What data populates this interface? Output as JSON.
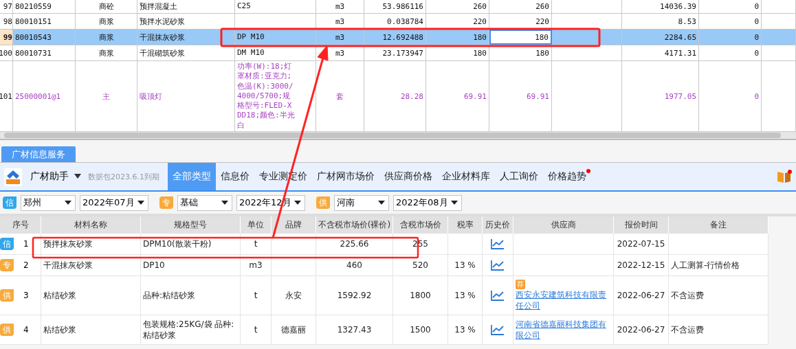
{
  "top_grid": {
    "rows": [
      {
        "index": "97",
        "code": "80210559",
        "type": "商砼",
        "name": "预拌混凝土",
        "spec": "C25",
        "unit": "m3",
        "quantity": "53.986116",
        "price_1": "260",
        "price_2": "260",
        "amount": "14036.39",
        "column_12": "0",
        "kind": "material",
        "selected": false
      },
      {
        "index": "98",
        "code": "80010151",
        "type": "商浆",
        "name": "预拌水泥砂浆",
        "spec": "",
        "unit": "m3",
        "quantity": "0.038784",
        "price_1": "220",
        "price_2": "220",
        "amount": "8.53",
        "column_12": "0",
        "kind": "material",
        "selected": false
      },
      {
        "index": "99",
        "code": "80010543",
        "type": "商浆",
        "name": "干混抹灰砂浆",
        "spec": "DP M10",
        "unit": "m3",
        "quantity": "12.692488",
        "price_1": "180",
        "price_2": "180",
        "amount": "2284.65",
        "column_12": "0",
        "kind": "material",
        "selected": true
      },
      {
        "index": "100",
        "code": "80010731",
        "type": "商浆",
        "name": "干混砌筑砂浆",
        "spec": "DM M10",
        "unit": "m3",
        "quantity": "23.173947",
        "price_1": "180",
        "price_2": "180",
        "amount": "4171.31",
        "column_12": "0",
        "kind": "material",
        "selected": false
      },
      {
        "index": "101",
        "code": "25000001@1",
        "type": "主",
        "name": "吸顶灯",
        "spec": "功率(W):18;灯罩材质:亚克力;色温(K):3000/4000/5700;规格型号:FLED-XDD18;颜色:半光白",
        "unit": "套",
        "quantity": "28.28",
        "price_1": "69.91",
        "price_2": "69.91",
        "amount": "1977.05",
        "column_12": "0",
        "kind": "main",
        "selected": false
      }
    ]
  },
  "panel_tab": {
    "label": "广材信息服务",
    "selected": true
  },
  "toolbar": {
    "app_name": "广材助手",
    "expiry": "数据包2023.6.1到期",
    "tabs": [
      {
        "label": "全部类型",
        "selected": true,
        "dot": false
      },
      {
        "label": "信息价",
        "selected": false,
        "dot": false
      },
      {
        "label": "专业测定价",
        "selected": false,
        "dot": false
      },
      {
        "label": "广材网市场价",
        "selected": false,
        "dot": false
      },
      {
        "label": "供应商价格",
        "selected": false,
        "dot": false
      },
      {
        "label": "企业材料库",
        "selected": false,
        "dot": false
      },
      {
        "label": "人工询价",
        "selected": false,
        "dot": false
      },
      {
        "label": "价格趋势",
        "selected": false,
        "dot": true
      }
    ]
  },
  "filters": [
    {
      "badge": "信",
      "kind": "info",
      "region": "郑州",
      "period": "2022年07月"
    },
    {
      "badge": "专",
      "kind": "pro",
      "region": "基础",
      "period": "2022年12月"
    },
    {
      "badge": "供",
      "kind": "supplier",
      "region": "河南",
      "period": "2022年08月"
    }
  ],
  "price_table": {
    "columns": [
      "序号",
      "材料名称",
      "规格型号",
      "单位",
      "品牌",
      "不含税市场价(裸价)",
      "含税市场价",
      "税率",
      "历史价",
      "供应商",
      "报价时间",
      "备注"
    ],
    "rows": [
      {
        "badge": "信",
        "kind": "info",
        "number": "1",
        "name": "预拌抹灰砂浆",
        "spec": "DPM10(散装干粉)",
        "unit": "t",
        "brand": "",
        "price_ex_tax": "225.66",
        "price_inc_tax": "255",
        "tax_rate": "",
        "supplier": "",
        "recommended": false,
        "date": "2022-07-15",
        "note": ""
      },
      {
        "badge": "专",
        "kind": "pro",
        "number": "2",
        "name": "干混抹灰砂浆",
        "spec": "DP10",
        "unit": "m3",
        "brand": "",
        "price_ex_tax": "460",
        "price_inc_tax": "520",
        "tax_rate": "13 %",
        "supplier": "",
        "recommended": false,
        "date": "2022-12-15",
        "note": "人工测算-行情价格"
      },
      {
        "badge": "供",
        "kind": "supplier",
        "number": "3",
        "name": "粘结砂浆",
        "spec": "品种:粘结砂浆",
        "unit": "t",
        "brand": "永安",
        "price_ex_tax": "1592.92",
        "price_inc_tax": "1800",
        "tax_rate": "13 %",
        "supplier": "西安永安建筑科技有限责任公司",
        "recommended": true,
        "recommend_label": "荐",
        "date": "2022-06-27",
        "note": "不含运费"
      },
      {
        "badge": "供",
        "kind": "supplier",
        "number": "4",
        "name": "粘结砂浆",
        "spec": "包装规格:25KG/袋 品种:粘结砂浆",
        "unit": "t",
        "brand": "德嘉丽",
        "price_ex_tax": "1327.43",
        "price_inc_tax": "1500",
        "tax_rate": "13 %",
        "supplier": "河南省德嘉丽科技集团有限公司",
        "recommended": false,
        "date": "2022-06-27",
        "note": "不含运费"
      }
    ]
  }
}
